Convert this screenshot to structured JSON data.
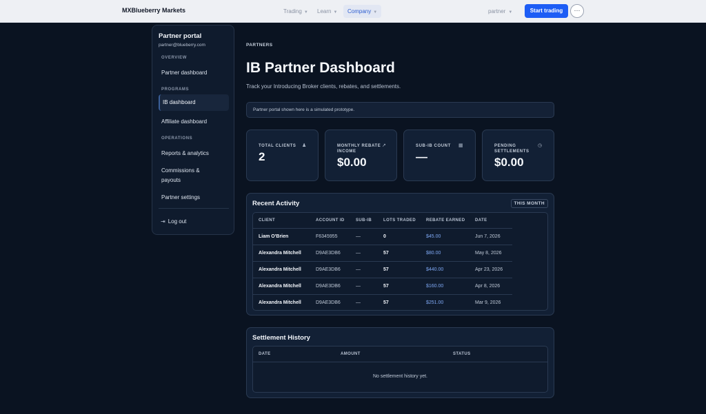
{
  "topbar": {
    "brand": "MXBlueberry Markets",
    "nav": [
      {
        "label": "Trading"
      },
      {
        "label": "Learn"
      },
      {
        "label": "Company"
      }
    ],
    "partner_label": "partner",
    "start_label": "Start trading",
    "more_label": "···"
  },
  "sidebar": {
    "title": "Partner portal",
    "email": "partner@blueberry.com",
    "sections": {
      "overview": "OVERVIEW",
      "programs": "PROGRAMS",
      "operations": "OPERATIONS"
    },
    "items": {
      "partner_dashboard": "Partner dashboard",
      "ib_dashboard": "IB dashboard",
      "affiliate_dashboard": "Affiliate dashboard",
      "reports": "Reports & analytics",
      "commissions": "Commissions & payouts",
      "settings": "Partner settings"
    },
    "logout": "Log out"
  },
  "main": {
    "crumb": "PARTNERS",
    "title": "IB Partner Dashboard",
    "subtitle": "Track your Introducing Broker clients, rebates, and settlements.",
    "notice": "Partner portal shown here is a simulated prototype."
  },
  "stats": [
    {
      "label": "TOTAL CLIENTS",
      "value": "2",
      "icon": "users-icon"
    },
    {
      "label": "MONTHLY REBATE INCOME",
      "value": "$0.00",
      "icon": "trend-icon"
    },
    {
      "label": "SUB-IB COUNT",
      "value": "—",
      "icon": "building-icon"
    },
    {
      "label": "PENDING SETTLEMENTS",
      "value": "$0.00",
      "icon": "clock-icon"
    }
  ],
  "activity": {
    "title": "Recent Activity",
    "badge": "THIS MONTH",
    "columns": [
      "CLIENT",
      "ACCOUNT ID",
      "SUB-IB",
      "LOTS TRADED",
      "REBATE EARNED",
      "DATE"
    ],
    "rows": [
      {
        "client": "Liam O'Brien",
        "account": "F6345955",
        "subib": "—",
        "lots": "0",
        "rebate": "$45.00",
        "date": "Jun 7, 2026"
      },
      {
        "client": "Alexandra Mitchell",
        "account": "D9AE3DB6",
        "subib": "—",
        "lots": "57",
        "rebate": "$80.00",
        "date": "May 8, 2026"
      },
      {
        "client": "Alexandra Mitchell",
        "account": "D9AE3DB6",
        "subib": "—",
        "lots": "57",
        "rebate": "$440.00",
        "date": "Apr 23, 2026"
      },
      {
        "client": "Alexandra Mitchell",
        "account": "D9AE3DB6",
        "subib": "—",
        "lots": "57",
        "rebate": "$160.00",
        "date": "Apr 8, 2026"
      },
      {
        "client": "Alexandra Mitchell",
        "account": "D9AE3DB6",
        "subib": "—",
        "lots": "57",
        "rebate": "$251.00",
        "date": "Mar 9, 2026"
      }
    ]
  },
  "settlement": {
    "title": "Settlement History",
    "columns": [
      "DATE",
      "AMOUNT",
      "STATUS"
    ],
    "empty": "No settlement history yet."
  },
  "colors": {
    "accent": "#1d5df5",
    "rebate": "#7fa9f5",
    "background": "#0a1321"
  }
}
